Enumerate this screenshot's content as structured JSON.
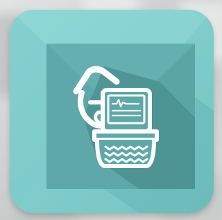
{
  "scene": {
    "subject": "app-icon",
    "icon_name": "paper-shredder-icon"
  },
  "colors": {
    "backdrop_light": "#e2e4e3",
    "backdrop_dark": "#b9bdbc",
    "tile": "#7ecbcb",
    "tile_highlight": "#8dd6d5",
    "inner_square": "#5aa3a4",
    "inner_square_light": "#66b0b1",
    "long_shadow": "#3f7f80",
    "glyph": "#ffffff"
  }
}
